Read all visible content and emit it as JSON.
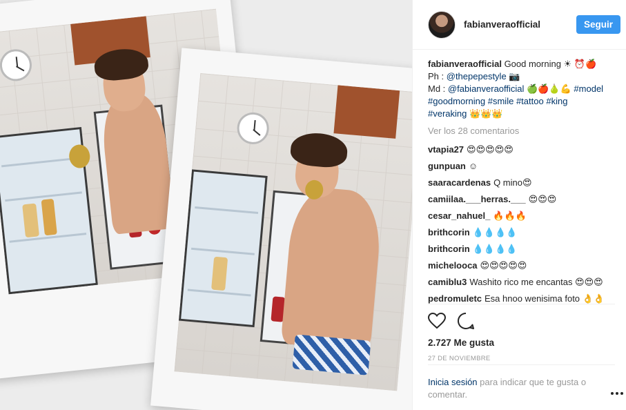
{
  "header": {
    "username": "fabianveraofficial",
    "follow_label": "Seguir"
  },
  "caption": {
    "username": "fabianveraofficial",
    "line1": "Good morning ☀ ⏰🍎",
    "ph_prefix": "Ph : ",
    "ph_link": "@thepepestyle",
    "ph_suffix": " 📷",
    "md_prefix": "Md : ",
    "md_link": "@fabianveraofficial",
    "md_suffix": " 🍏🍎🍐💪",
    "tags": [
      "#model",
      "#goodmorning",
      "#smile",
      "#tattoo",
      "#king",
      "#veraking"
    ],
    "end": " 👑👑👑"
  },
  "view_all": "Ver los 28 comentarios",
  "comments": [
    {
      "user": "vtapia27",
      "text": "😍😍😍😍😍"
    },
    {
      "user": "gunpuan",
      "text": "☺"
    },
    {
      "user": "saaracardenas",
      "text": "Q mino😍"
    },
    {
      "user": "camiilaa.___herras.___",
      "text": "😍😍😍"
    },
    {
      "user": "cesar_nahuel_",
      "text": "🔥🔥🔥"
    },
    {
      "user": "brithcorin",
      "text": "💧💧💧💧"
    },
    {
      "user": "brithcorin",
      "text": "💧💧💧💧"
    },
    {
      "user": "michelooca",
      "text": "😍😍😍😍😍"
    },
    {
      "user": "camiblu3",
      "text": "Washito rico me encantas 😍😍😍"
    },
    {
      "user": "pedromuletc",
      "text": "Esa hnoo wenisima foto 👌👌"
    }
  ],
  "likes": "2.727 Me gusta",
  "date": "27 DE NOVIEMBRE",
  "login": {
    "link": "Inicia sesión",
    "text": " para indicar que te gusta o comentar."
  },
  "icons": {
    "like": "heart-icon",
    "comment": "comment-icon",
    "more": "more-options-icon"
  }
}
